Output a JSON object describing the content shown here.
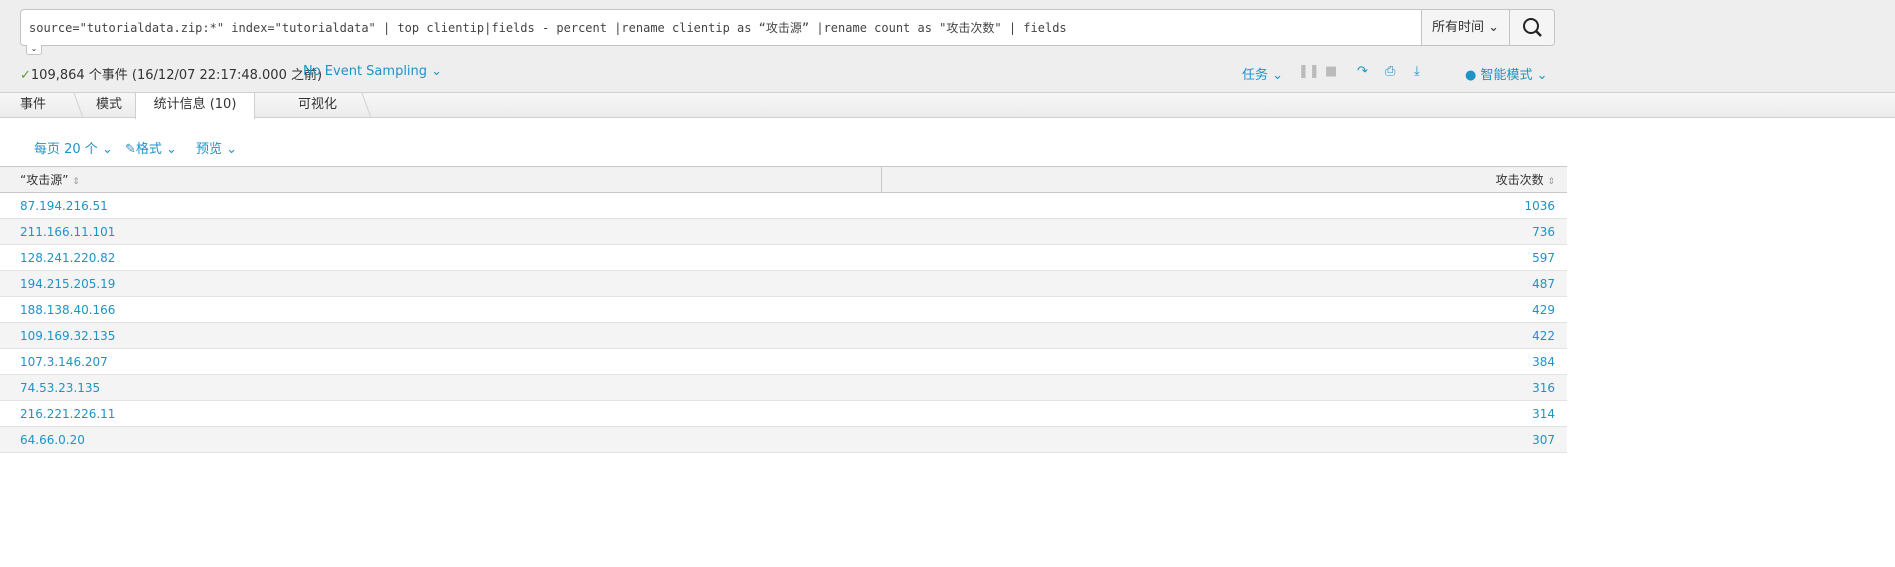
{
  "search": {
    "query": "source=\"tutorialdata.zip:*\" index=\"tutorialdata\" | top clientip|fields - percent |rename clientip as “攻击源” |rename count as \"攻击次数\" | fields",
    "time_range": "所有时间"
  },
  "status": {
    "events": "109,864 个事件 (16/12/07 22:17:48.000 之前)",
    "sampling": "No Event Sampling"
  },
  "job": {
    "label": "任务",
    "mode": "智能模式"
  },
  "tabs": [
    {
      "label": "事件"
    },
    {
      "label": "模式"
    },
    {
      "label": "统计信息 (10)"
    },
    {
      "label": "可视化"
    }
  ],
  "toolbar": {
    "per_page": "每页 20 个",
    "format": "格式",
    "preview": "预览"
  },
  "table": {
    "columns": [
      "“攻击源”",
      "攻击次数"
    ],
    "rows": [
      [
        "87.194.216.51",
        "1036"
      ],
      [
        "211.166.11.101",
        "736"
      ],
      [
        "128.241.220.82",
        "597"
      ],
      [
        "194.215.205.19",
        "487"
      ],
      [
        "188.138.40.166",
        "429"
      ],
      [
        "109.169.32.135",
        "422"
      ],
      [
        "107.3.146.207",
        "384"
      ],
      [
        "74.53.23.135",
        "316"
      ],
      [
        "216.221.226.11",
        "314"
      ],
      [
        "64.66.0.20",
        "307"
      ]
    ]
  }
}
